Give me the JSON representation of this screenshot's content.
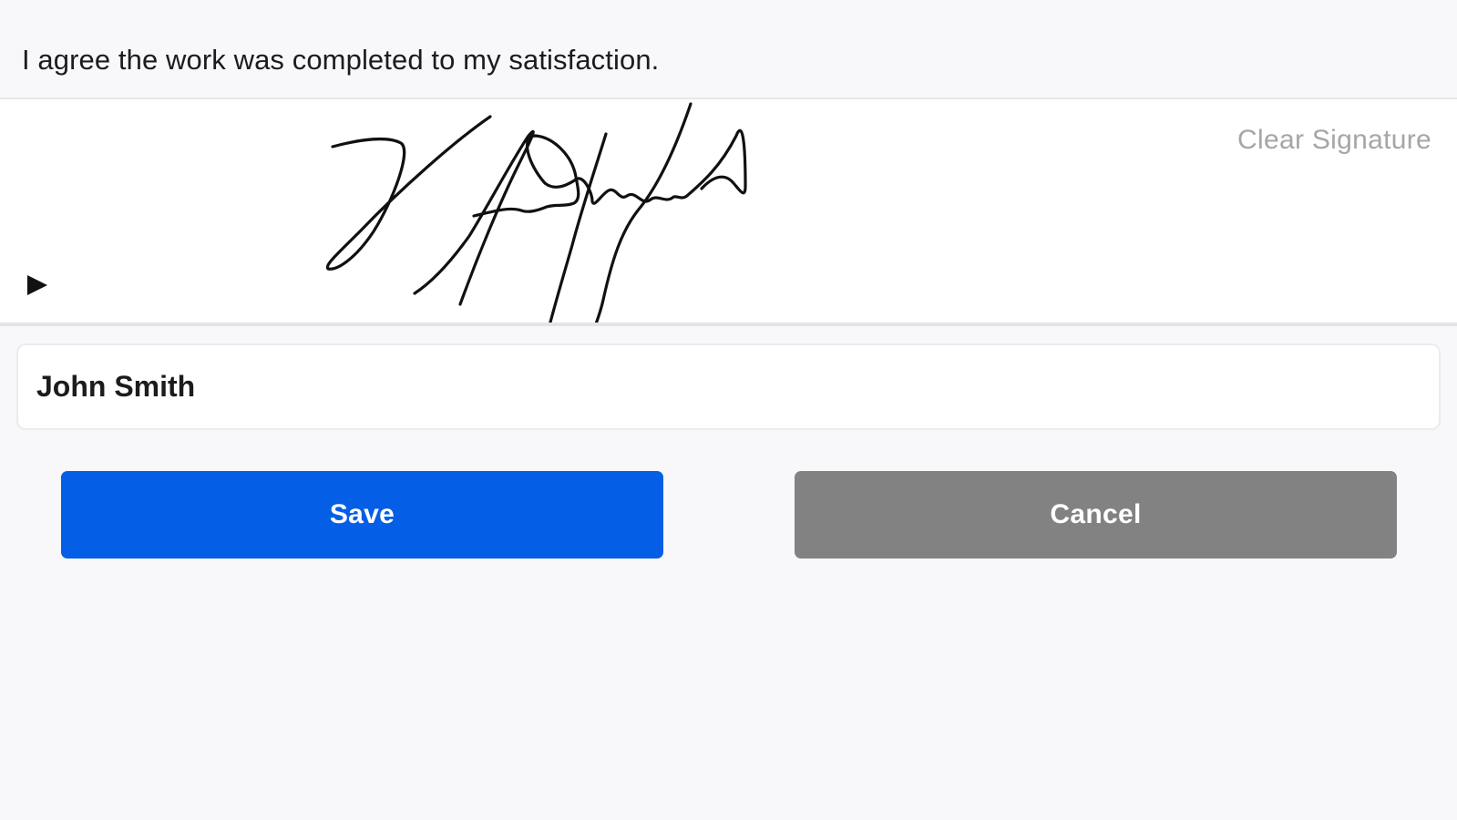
{
  "agreement": {
    "text": "I agree the work was completed to my satisfaction."
  },
  "signature_pad": {
    "clear_label": "Clear Signature",
    "play_icon": "play-icon"
  },
  "name_field": {
    "value": "John Smith",
    "placeholder": ""
  },
  "actions": {
    "save_label": "Save",
    "cancel_label": "Cancel"
  },
  "colors": {
    "save_button": "#055fe6",
    "cancel_button": "#828282",
    "clear_link": "#a5a5aa",
    "caret": "#1f5cff"
  }
}
